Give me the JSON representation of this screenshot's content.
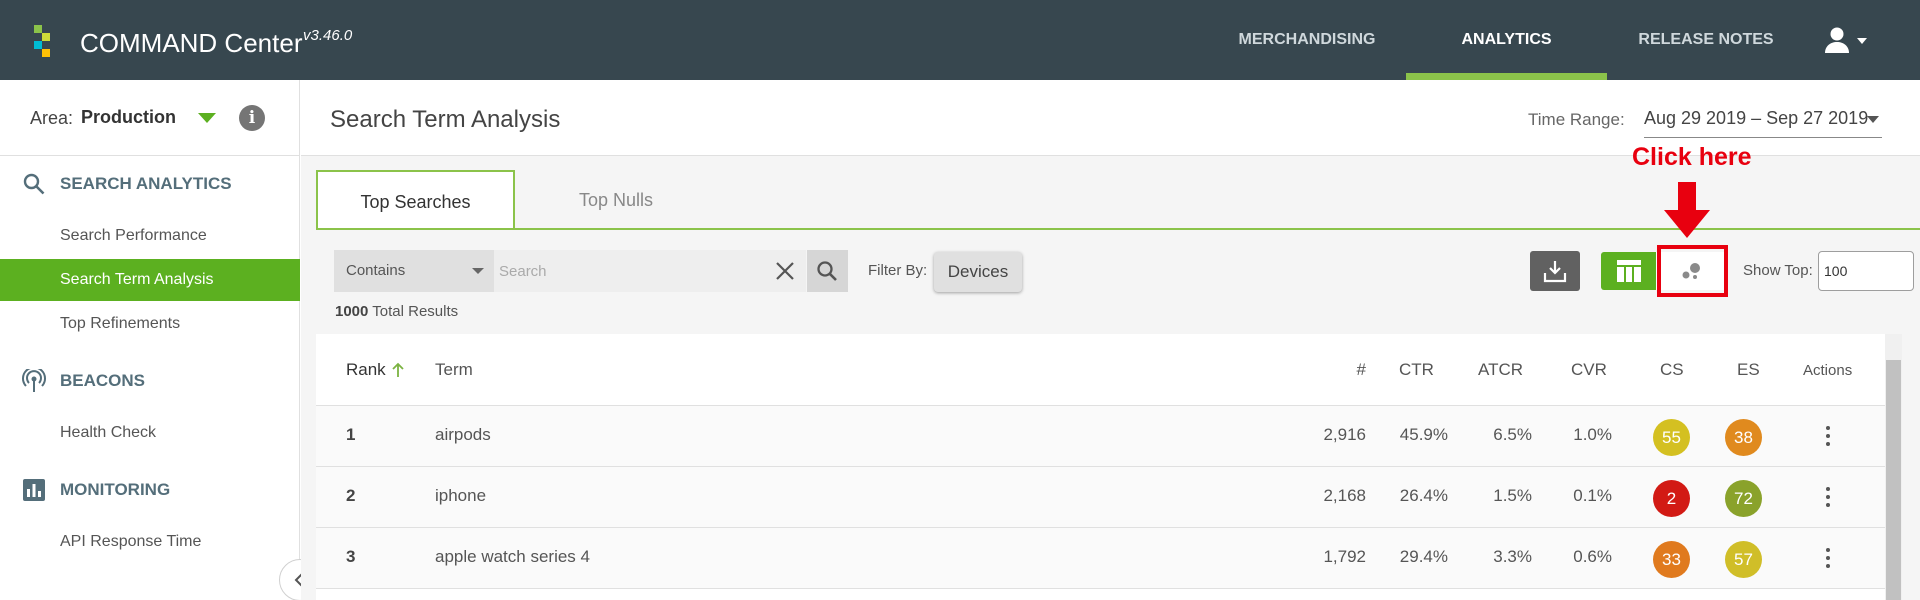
{
  "app": {
    "title": "COMMAND Center",
    "version": "v3.46.0",
    "logo_colors": [
      "#8bc34a",
      "#cddc39",
      "#00bcd4",
      "#ffc107"
    ]
  },
  "nav": {
    "items": [
      {
        "label": "MERCHANDISING",
        "active": false
      },
      {
        "label": "ANALYTICS",
        "active": true
      },
      {
        "label": "RELEASE NOTES",
        "active": false
      }
    ],
    "user_icon": "user-icon"
  },
  "sidebar": {
    "area_label": "Area:",
    "area_value": "Production",
    "sections": [
      {
        "title": "SEARCH ANALYTICS",
        "icon": "search-icon",
        "items": [
          "Search Performance",
          "Search Term Analysis",
          "Top Refinements"
        ]
      },
      {
        "title": "BEACONS",
        "icon": "beacon-icon",
        "items": [
          "Health Check"
        ]
      },
      {
        "title": "MONITORING",
        "icon": "chart-icon",
        "items": [
          "API Response Time"
        ]
      }
    ],
    "active_item": "Search Term Analysis"
  },
  "page": {
    "title": "Search Term Analysis",
    "time_range_label": "Time Range:",
    "time_range_value": "Aug 29 2019 – Sep 27 2019"
  },
  "tabs": [
    {
      "label": "Top Searches",
      "active": true
    },
    {
      "label": "Top Nulls",
      "active": false
    }
  ],
  "filters": {
    "match_type": "Contains",
    "search_placeholder": "Search",
    "filter_by_label": "Filter By:",
    "devices_label": "Devices",
    "total_results_count": "1000",
    "total_results_suffix": " Total Results",
    "show_top_label": "Show Top:",
    "show_top_value": "100"
  },
  "annotation": {
    "text": "Click here",
    "color": "#e8000f"
  },
  "table": {
    "headers": {
      "rank": "Rank",
      "term": "Term",
      "count": "#",
      "ctr": "CTR",
      "atcr": "ATCR",
      "cvr": "CVR",
      "cs": "CS",
      "es": "ES",
      "actions": "Actions"
    },
    "rows": [
      {
        "rank": "1",
        "term": "airpods",
        "count": "2,916",
        "ctr": "45.9%",
        "atcr": "6.5%",
        "cvr": "1.0%",
        "cs": "55",
        "cs_color": "#d4c021",
        "es": "38",
        "es_color": "#e08a1e"
      },
      {
        "rank": "2",
        "term": "iphone",
        "count": "2,168",
        "ctr": "26.4%",
        "atcr": "1.5%",
        "cvr": "0.1%",
        "cs": "2",
        "cs_color": "#d21a14",
        "es": "72",
        "es_color": "#8aa22b"
      },
      {
        "rank": "3",
        "term": "apple watch series 4",
        "count": "1,792",
        "ctr": "29.4%",
        "atcr": "3.3%",
        "cvr": "0.6%",
        "cs": "33",
        "cs_color": "#e07a1e",
        "es": "57",
        "es_color": "#d0be28"
      }
    ]
  }
}
